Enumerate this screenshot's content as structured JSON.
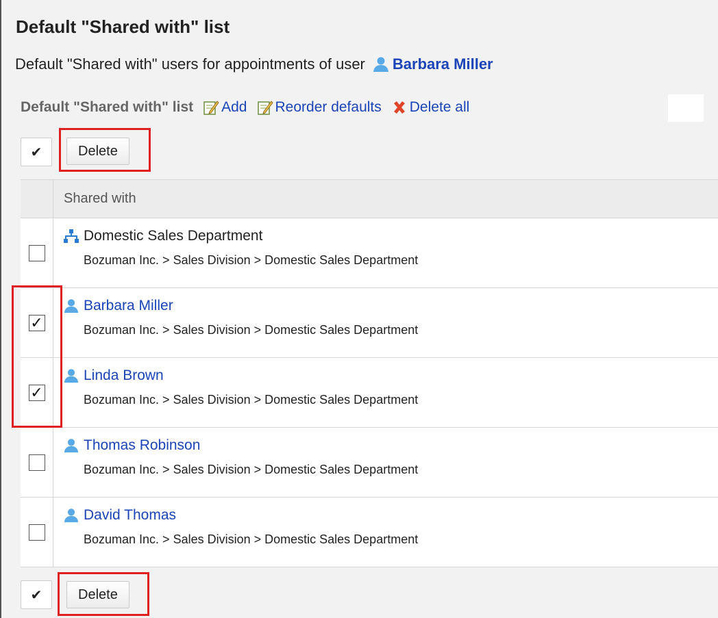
{
  "page": {
    "title": "Default \"Shared with\" list",
    "subtitle_text": "Default \"Shared with\" users for appointments of user",
    "subtitle_user": "Barbara Miller"
  },
  "toolbar": {
    "label": "Default \"Shared with\" list",
    "add": "Add",
    "reorder": "Reorder defaults",
    "delete_all": "Delete all"
  },
  "actions": {
    "check_all_glyph": "✔",
    "delete_label": "Delete"
  },
  "table": {
    "header": "Shared with",
    "rows": [
      {
        "type": "department",
        "name": "Domestic Sales Department",
        "path": "Bozuman Inc. > Sales Division > Domestic Sales Department",
        "checked": false
      },
      {
        "type": "user",
        "name": "Barbara Miller",
        "path": "Bozuman Inc. > Sales Division > Domestic Sales Department",
        "checked": true
      },
      {
        "type": "user",
        "name": "Linda Brown",
        "path": "Bozuman Inc. > Sales Division > Domestic Sales Department",
        "checked": true
      },
      {
        "type": "user",
        "name": "Thomas Robinson",
        "path": "Bozuman Inc. > Sales Division > Domestic Sales Department",
        "checked": false
      },
      {
        "type": "user",
        "name": "David Thomas",
        "path": "Bozuman Inc. > Sales Division > Domestic Sales Department",
        "checked": false
      }
    ]
  },
  "icons": {
    "user": "user-icon",
    "department": "org-chart-icon",
    "edit": "edit-icon",
    "delete": "delete-x-icon"
  },
  "colors": {
    "link": "#1a44b8",
    "highlight": "#e02020",
    "user_icon": "#59a9e6",
    "delete_icon": "#e0452a"
  }
}
